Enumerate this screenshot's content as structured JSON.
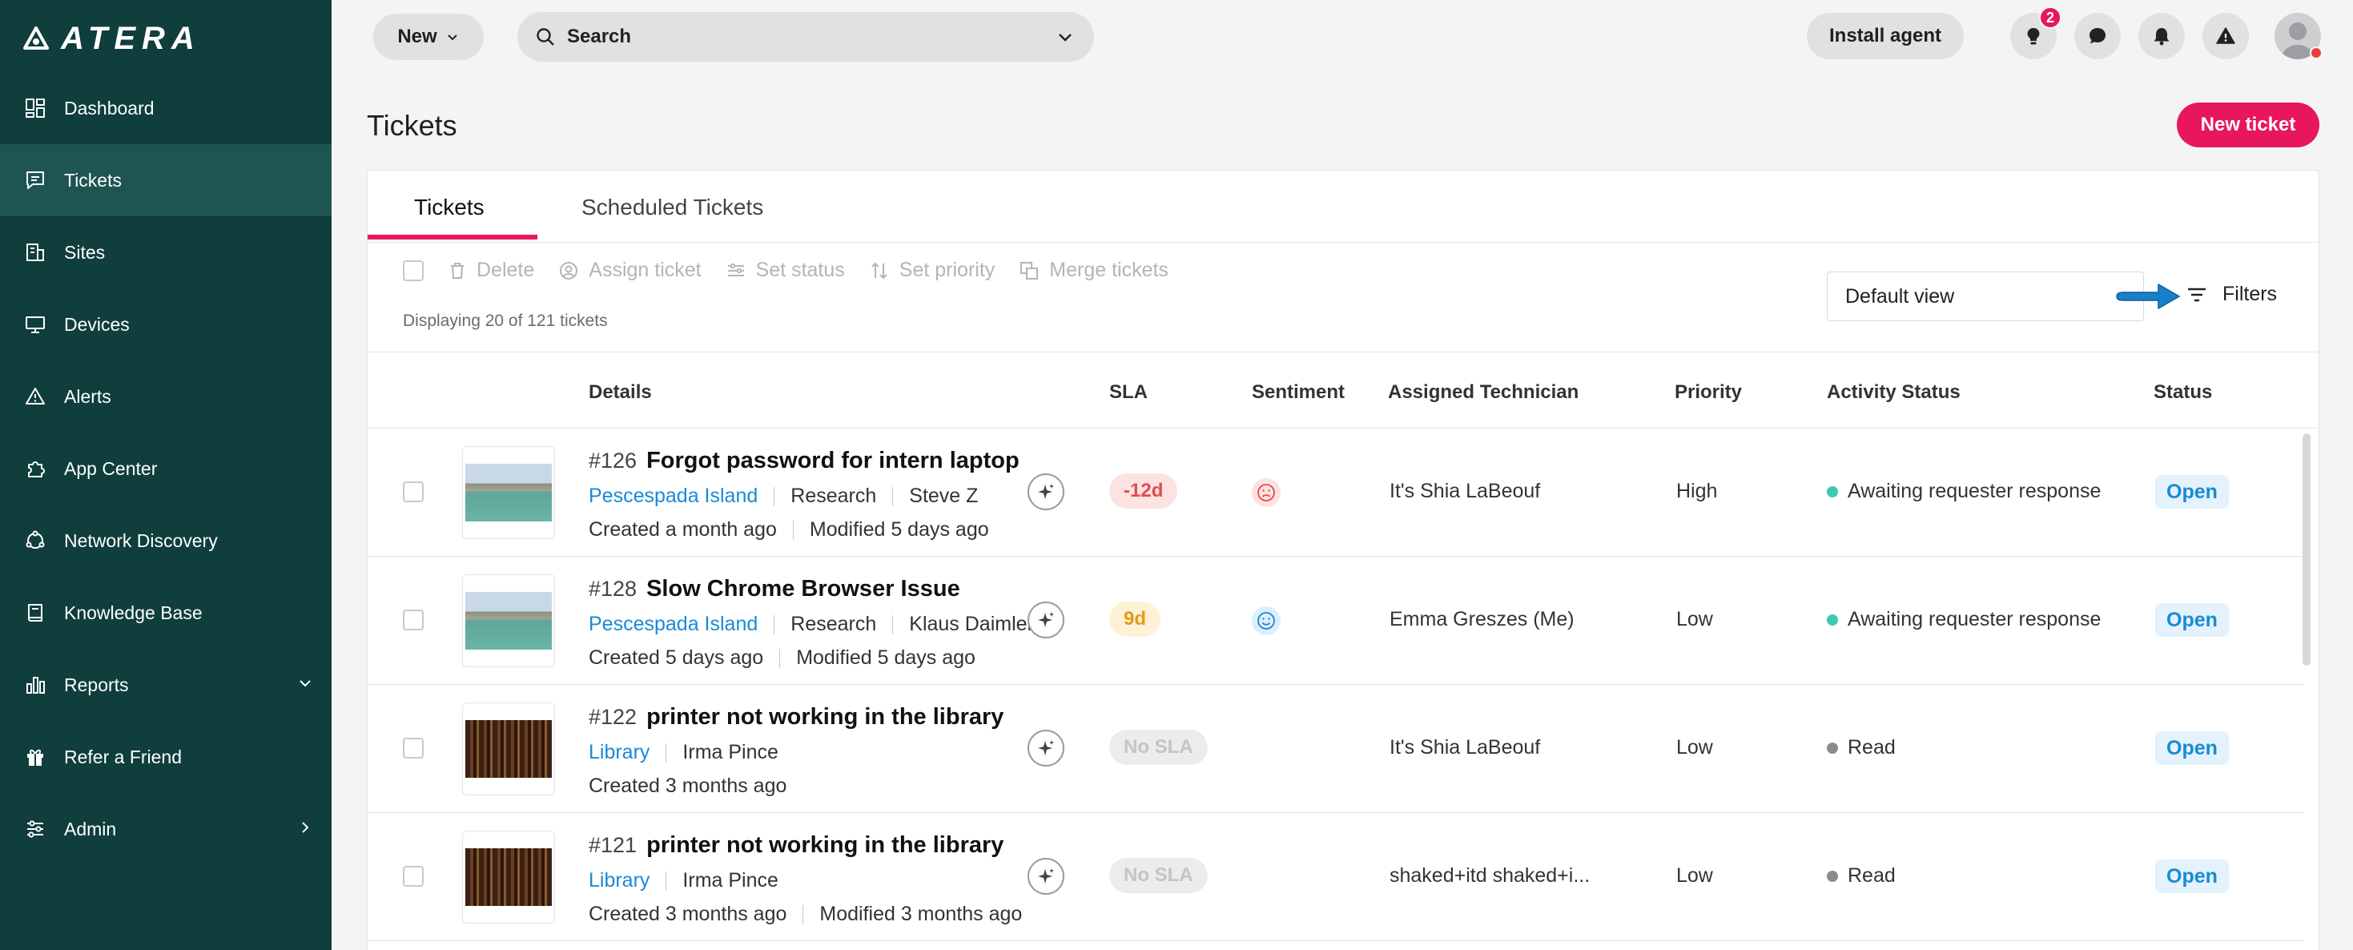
{
  "app": {
    "brand": "ATERA"
  },
  "sidebar": {
    "items": [
      {
        "label": "Dashboard",
        "icon": "dashboard-icon",
        "active": false
      },
      {
        "label": "Tickets",
        "icon": "tickets-icon",
        "active": true
      },
      {
        "label": "Sites",
        "icon": "sites-icon",
        "active": false
      },
      {
        "label": "Devices",
        "icon": "devices-icon",
        "active": false
      },
      {
        "label": "Alerts",
        "icon": "alerts-icon",
        "active": false
      },
      {
        "label": "App Center",
        "icon": "app-center-icon",
        "active": false
      },
      {
        "label": "Network Discovery",
        "icon": "network-discovery-icon",
        "active": false
      },
      {
        "label": "Knowledge Base",
        "icon": "knowledge-base-icon",
        "active": false
      },
      {
        "label": "Reports",
        "icon": "reports-icon",
        "active": false
      },
      {
        "label": "Refer a Friend",
        "icon": "gift-icon",
        "active": false
      },
      {
        "label": "Admin",
        "icon": "admin-icon",
        "active": false
      }
    ]
  },
  "topbar": {
    "new_label": "New",
    "search_label": "Search",
    "install_label": "Install agent",
    "lightbulb_badge": "2"
  },
  "page": {
    "title": "Tickets",
    "new_ticket_label": "New ticket"
  },
  "tabs": [
    "Tickets",
    "Scheduled Tickets"
  ],
  "toolbar": {
    "delete": "Delete",
    "assign": "Assign ticket",
    "set_status": "Set status",
    "set_priority": "Set priority",
    "merge": "Merge tickets",
    "displaying": "Displaying 20 of 121 tickets",
    "view": "Default view",
    "filters": "Filters"
  },
  "columns": {
    "details": "Details",
    "sla": "SLA",
    "sentiment": "Sentiment",
    "technician": "Assigned Technician",
    "priority": "Priority",
    "activity": "Activity Status",
    "status": "Status"
  },
  "tickets": [
    {
      "number": "#126",
      "title": "Forgot password for intern laptop",
      "site": "Pescespada Island",
      "meta": [
        "Research",
        "Steve Z"
      ],
      "created": "Created a month ago",
      "modified": "Modified 5 days ago",
      "sla": "-12d",
      "technician": "It's Shia LaBeouf",
      "priority": "High",
      "activity": "Awaiting requester response",
      "status": "Open"
    },
    {
      "number": "#128",
      "title": "Slow Chrome Browser Issue",
      "site": "Pescespada Island",
      "meta": [
        "Research",
        "Klaus Daimler"
      ],
      "created": "Created 5 days ago",
      "modified": "Modified 5 days ago",
      "sla": "9d",
      "technician": "Emma Greszes (Me)",
      "priority": "Low",
      "activity": "Awaiting requester response",
      "status": "Open"
    },
    {
      "number": "#122",
      "title": "printer not working in the library",
      "site": "Library",
      "meta": [
        "Irma Pince"
      ],
      "created": "Created 3 months ago",
      "modified": "",
      "sla": "No SLA",
      "technician": "It's Shia LaBeouf",
      "priority": "Low",
      "activity": "Read",
      "status": "Open"
    },
    {
      "number": "#121",
      "title": "printer not working in the library",
      "site": "Library",
      "meta": [
        "Irma Pince"
      ],
      "created": "Created 3 months ago",
      "modified": "Modified 3 months ago",
      "sla": "No SLA",
      "technician": "shaked+itd shaked+i...",
      "priority": "Low",
      "activity": "Read",
      "status": "Open"
    }
  ],
  "colors": {
    "sidebar_bg": "#0f3e3c",
    "sidebar_active": "#1e5451",
    "accent": "#e8175d",
    "link": "#1a8ad6",
    "activity_teal": "#3ec9b0",
    "activity_grey": "#8a8a8f"
  }
}
